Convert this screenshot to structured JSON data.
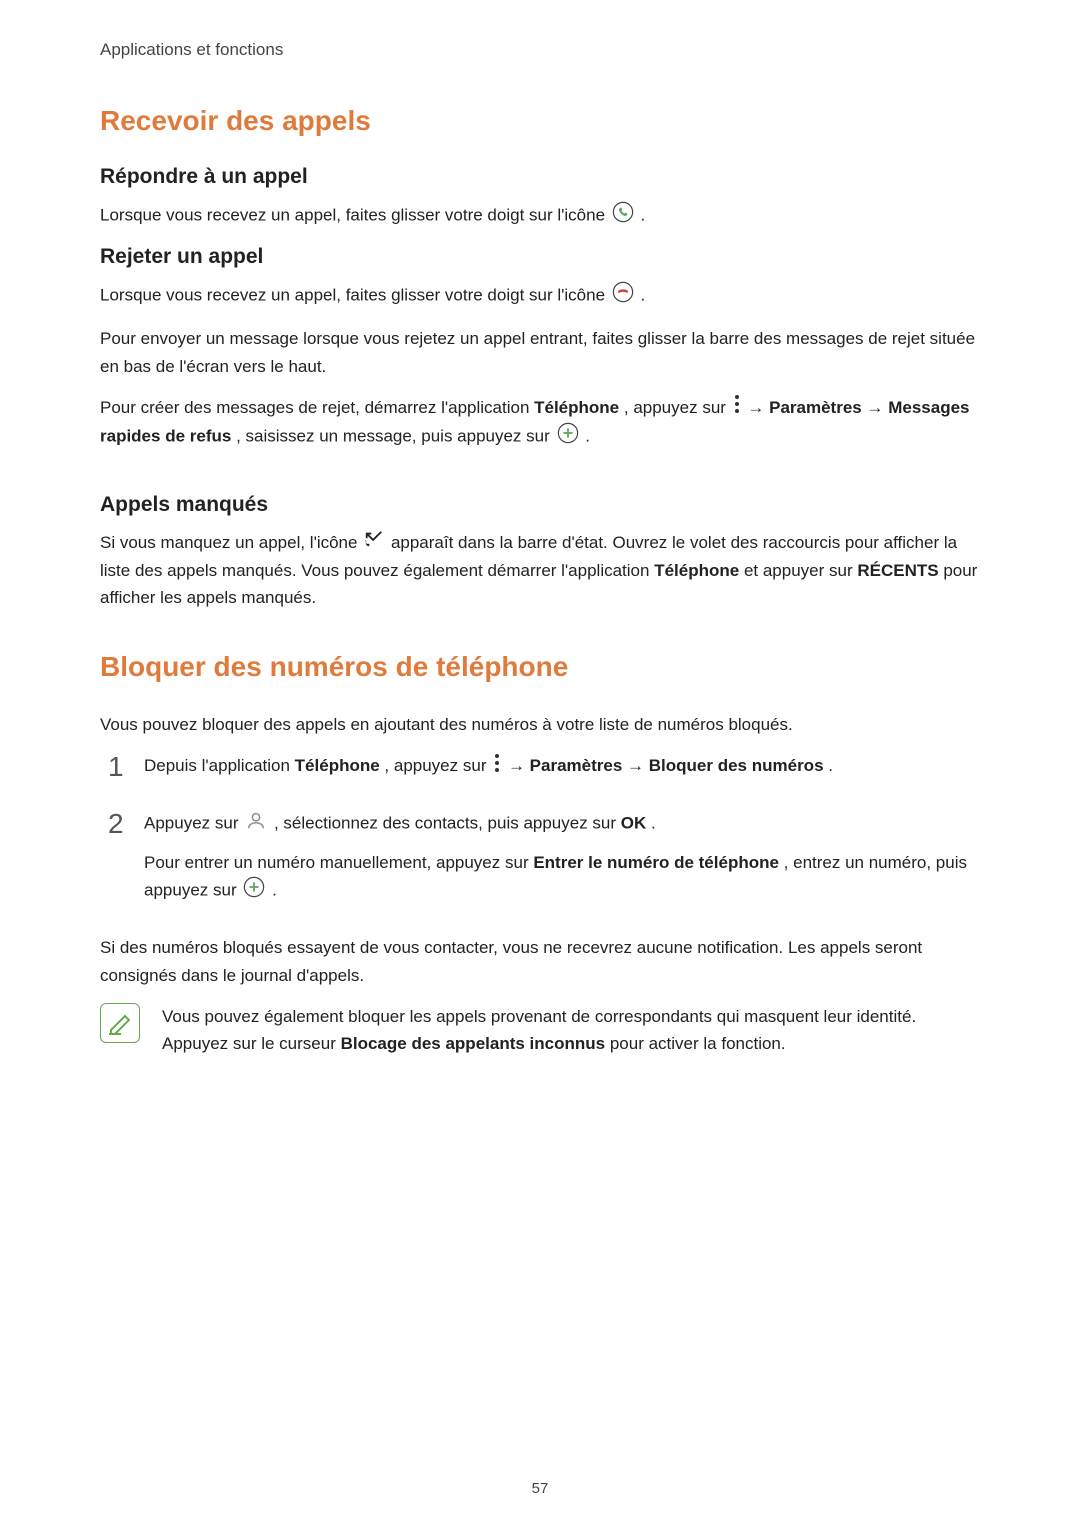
{
  "header": "Applications et fonctions",
  "section1": {
    "title": "Recevoir des appels",
    "sub1": {
      "title": "Répondre à un appel",
      "p1a": "Lorsque vous recevez un appel, faites glisser votre doigt sur l'icône ",
      "p1b": "."
    },
    "sub2": {
      "title": "Rejeter un appel",
      "p1a": "Lorsque vous recevez un appel, faites glisser votre doigt sur l'icône ",
      "p1b": ".",
      "p2": "Pour envoyer un message lorsque vous rejetez un appel entrant, faites glisser la barre des messages de rejet située en bas de l'écran vers le haut.",
      "p3a": "Pour créer des messages de rejet, démarrez l'application ",
      "p3b": "Téléphone",
      "p3c": ", appuyez sur ",
      "p3d": " → ",
      "p3e": "Paramètres",
      "p3f": " → ",
      "p3g": "Messages rapides de refus",
      "p3h": ", saisissez un message, puis appuyez sur ",
      "p3i": "."
    },
    "sub3": {
      "title": "Appels manqués",
      "p1a": "Si vous manquez un appel, l'icône ",
      "p1b": " apparaît dans la barre d'état. Ouvrez le volet des raccourcis pour afficher la liste des appels manqués. Vous pouvez également démarrer l'application ",
      "p1c": "Téléphone",
      "p1d": " et appuyer sur ",
      "p1e": "RÉCENTS",
      "p1f": " pour afficher les appels manqués."
    }
  },
  "section2": {
    "title": "Bloquer des numéros de téléphone",
    "intro": "Vous pouvez bloquer des appels en ajoutant des numéros à votre liste de numéros bloqués.",
    "step1": {
      "num": "1",
      "a": "Depuis l'application ",
      "b": "Téléphone",
      "c": ", appuyez sur ",
      "d": " → ",
      "e": "Paramètres",
      "f": " → ",
      "g": "Bloquer des numéros",
      "h": "."
    },
    "step2": {
      "num": "2",
      "p1a": "Appuyez sur ",
      "p1b": ", sélectionnez des contacts, puis appuyez sur ",
      "p1c": "OK",
      "p1d": ".",
      "p2a": "Pour entrer un numéro manuellement, appuyez sur ",
      "p2b": "Entrer le numéro de téléphone",
      "p2c": ", entrez un numéro, puis appuyez sur ",
      "p2d": "."
    },
    "after": "Si des numéros bloqués essayent de vous contacter, vous ne recevrez aucune notification. Les appels seront consignés dans le journal d'appels.",
    "note": {
      "a": "Vous pouvez également bloquer les appels provenant de correspondants qui masquent leur identité. Appuyez sur le curseur ",
      "b": "Blocage des appelants inconnus",
      "c": " pour activer la fonction."
    }
  },
  "pageNumber": "57"
}
